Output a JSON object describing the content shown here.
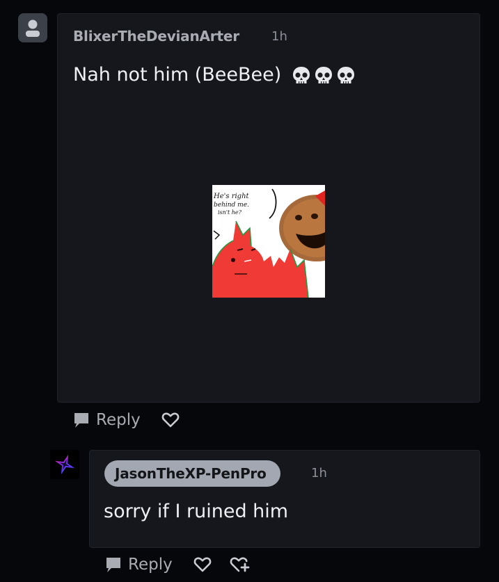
{
  "comment": {
    "author": "BlixerTheDevianArter",
    "time": "1h",
    "text": "Nah not him (BeeBee)",
    "emojis": [
      "skull-icon",
      "skull-icon",
      "skull-icon"
    ],
    "image_text": "He's right behind me. isn't he?",
    "actions": {
      "reply_label": "Reply",
      "like_icon": "heart-icon"
    }
  },
  "reply": {
    "author": "JasonTheXP-PenPro",
    "time": "1h",
    "text": "sorry if I ruined him",
    "actions": {
      "reply_label": "Reply",
      "like_icon": "heart-icon",
      "gift_icon": "heart-plus-icon"
    }
  },
  "colors": {
    "background": "#06070b",
    "card": "#15171d",
    "name_pill": "#a3a7b1"
  }
}
